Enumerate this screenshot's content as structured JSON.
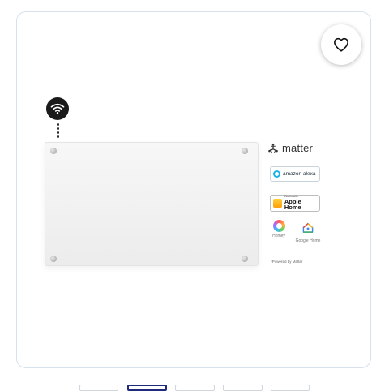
{
  "favorite": {
    "icon": "heart-icon"
  },
  "wifi": {
    "icon": "wifi-icon"
  },
  "product": {
    "type": "glass panel heater"
  },
  "badges": {
    "matter": "matter",
    "alexa": "amazon alexa",
    "apple_small": "Works with",
    "apple_big": "Apple Home",
    "homey": "Homey",
    "google": "Google Home",
    "powered": "*Powered by Matter"
  },
  "colors": {
    "card_border": "#d7e1ec",
    "active_thumb": "#1f2a7a",
    "alexa": "#19b3e6"
  },
  "thumbnails": {
    "count": 5,
    "active_index": 1
  }
}
